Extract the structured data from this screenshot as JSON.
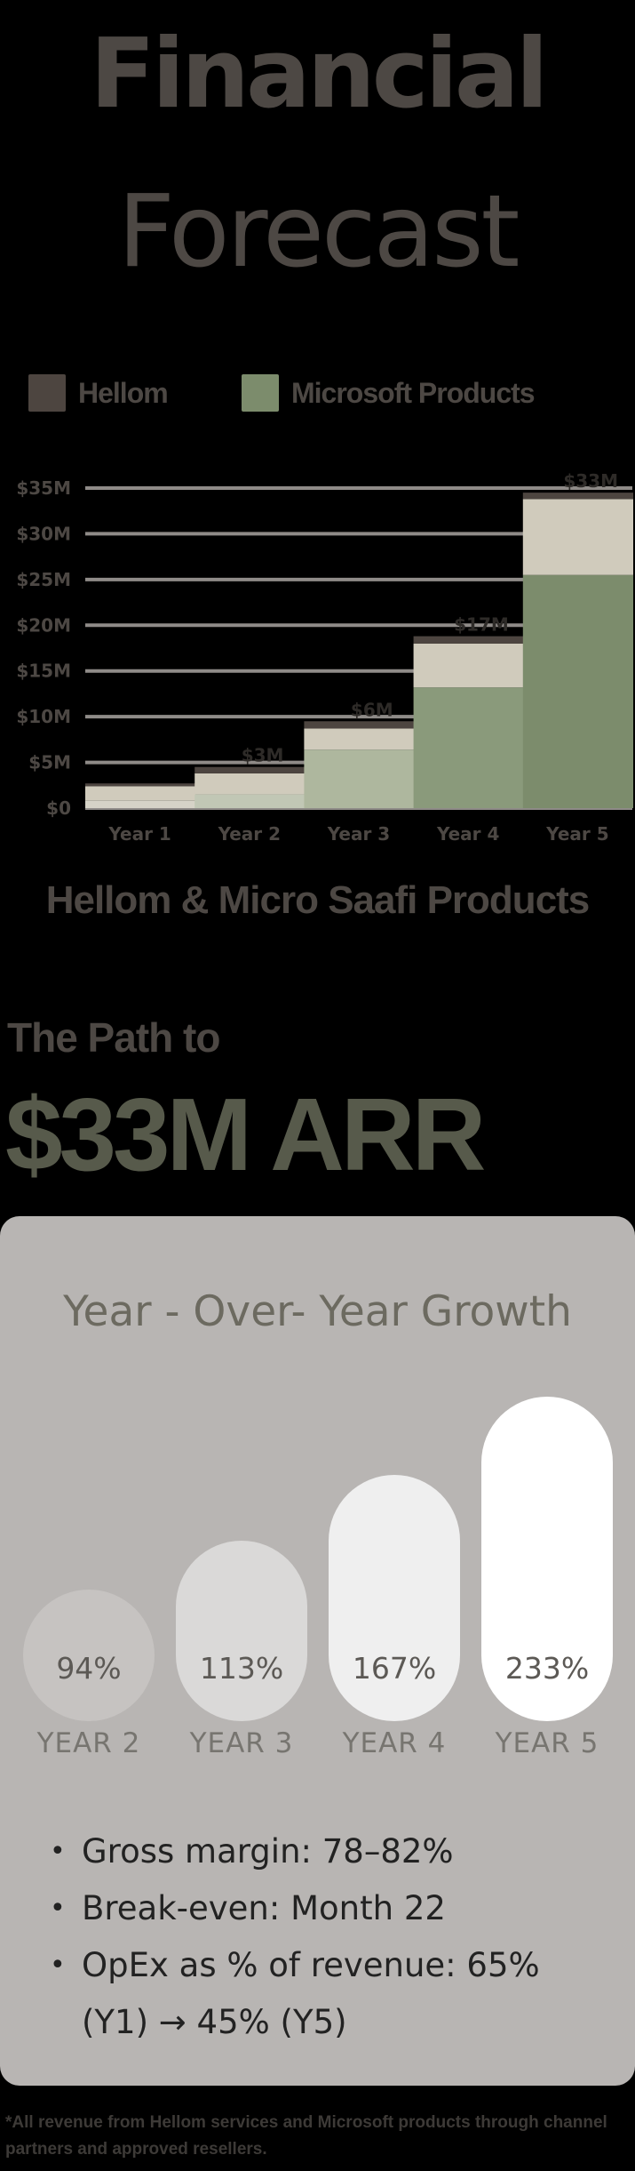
{
  "title": {
    "line1": "Financial",
    "line2": "Forecast"
  },
  "legend": [
    {
      "label": "Hellom",
      "color": "#4d4540"
    },
    {
      "label": "Microsoft Products",
      "color": "#7c8c6c"
    }
  ],
  "chart_data": {
    "type": "bar",
    "stacked": true,
    "categories": [
      "Year 1",
      "Year 2",
      "Year 3",
      "Year 4",
      "Year 5"
    ],
    "y_tick_labels": [
      "$0",
      "$5M",
      "$10M",
      "$15M",
      "$20M",
      "$25M",
      "$30M",
      "$35M"
    ],
    "ylim": [
      0,
      35
    ],
    "value_labels": [
      "",
      "$3M",
      "$6M",
      "$17M",
      "$33M"
    ],
    "totals": [
      2.7,
      4.5,
      9.5,
      18.8,
      34.5
    ],
    "segments": {
      "bottom": [
        0.8,
        1.5,
        6.4,
        13.2,
        25.5
      ],
      "middle": [
        1.6,
        2.3,
        2.3,
        4.8,
        8.3
      ],
      "top": [
        0.3,
        0.7,
        0.8,
        0.8,
        0.7
      ]
    },
    "colors": {
      "bottom": [
        "#d6d3c7",
        "#c1c7b5",
        "#aeb79e",
        "#8a9a7b",
        "#7c8c6c"
      ],
      "middle": "#d0cbbc",
      "top": "#4d4540"
    },
    "grid": true,
    "legend_position": "top"
  },
  "chart_caption": "Hellom & Micro Saafi Products",
  "kicker": "The Path to",
  "headline": "$33M ARR",
  "growth": {
    "title": "Year - Over- Year Growth",
    "items": [
      {
        "value": "94%",
        "year": "YEAR 2",
        "color": "#c6c3c1",
        "level": 0.41
      },
      {
        "value": "113%",
        "year": "YEAR 3",
        "color": "#dad9d8",
        "level": 0.56
      },
      {
        "value": "167%",
        "year": "YEAR 4",
        "color": "#efefef",
        "level": 0.76
      },
      {
        "value": "233%",
        "year": "YEAR 5",
        "color": "#ffffff",
        "level": 1.0
      }
    ]
  },
  "bullets": [
    "Gross margin: 78–82%",
    "Break-even: Month 22",
    "OpEx as % of revenue: 65% (Y1) → 45% (Y5)"
  ],
  "footnote": "*All revenue from Hellom services and Microsoft products through channel partners and approved resellers."
}
